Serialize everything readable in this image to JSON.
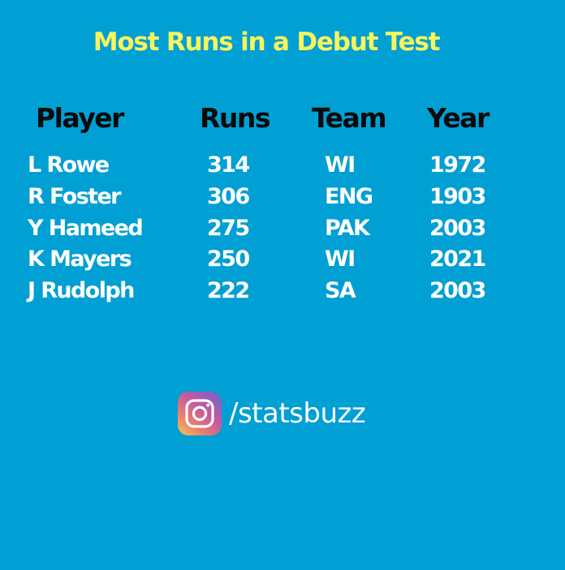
{
  "title": "Most Runs in a Debut Test",
  "table": {
    "headers": [
      "Player",
      "Runs",
      "Team",
      "Year"
    ],
    "rows": [
      {
        "player": "L Rowe",
        "runs": "314",
        "team": "WI",
        "year": "1972"
      },
      {
        "player": "R Foster",
        "runs": "306",
        "team": "ENG",
        "year": "1903"
      },
      {
        "player": "Y Hameed",
        "runs": "275",
        "team": "PAK",
        "year": "2003"
      },
      {
        "player": "K Mayers",
        "runs": "250",
        "team": "WI",
        "year": "2021"
      },
      {
        "player": "J Rudolph",
        "runs": "222",
        "team": "SA",
        "year": "2003"
      }
    ]
  },
  "social": {
    "icon": "instagram-icon",
    "handle": "/statsbuzz"
  },
  "colors": {
    "background": "#009fd4",
    "title": "#f7f55e",
    "header_text": "#0a0a0a",
    "body_text": "#ffffff"
  }
}
